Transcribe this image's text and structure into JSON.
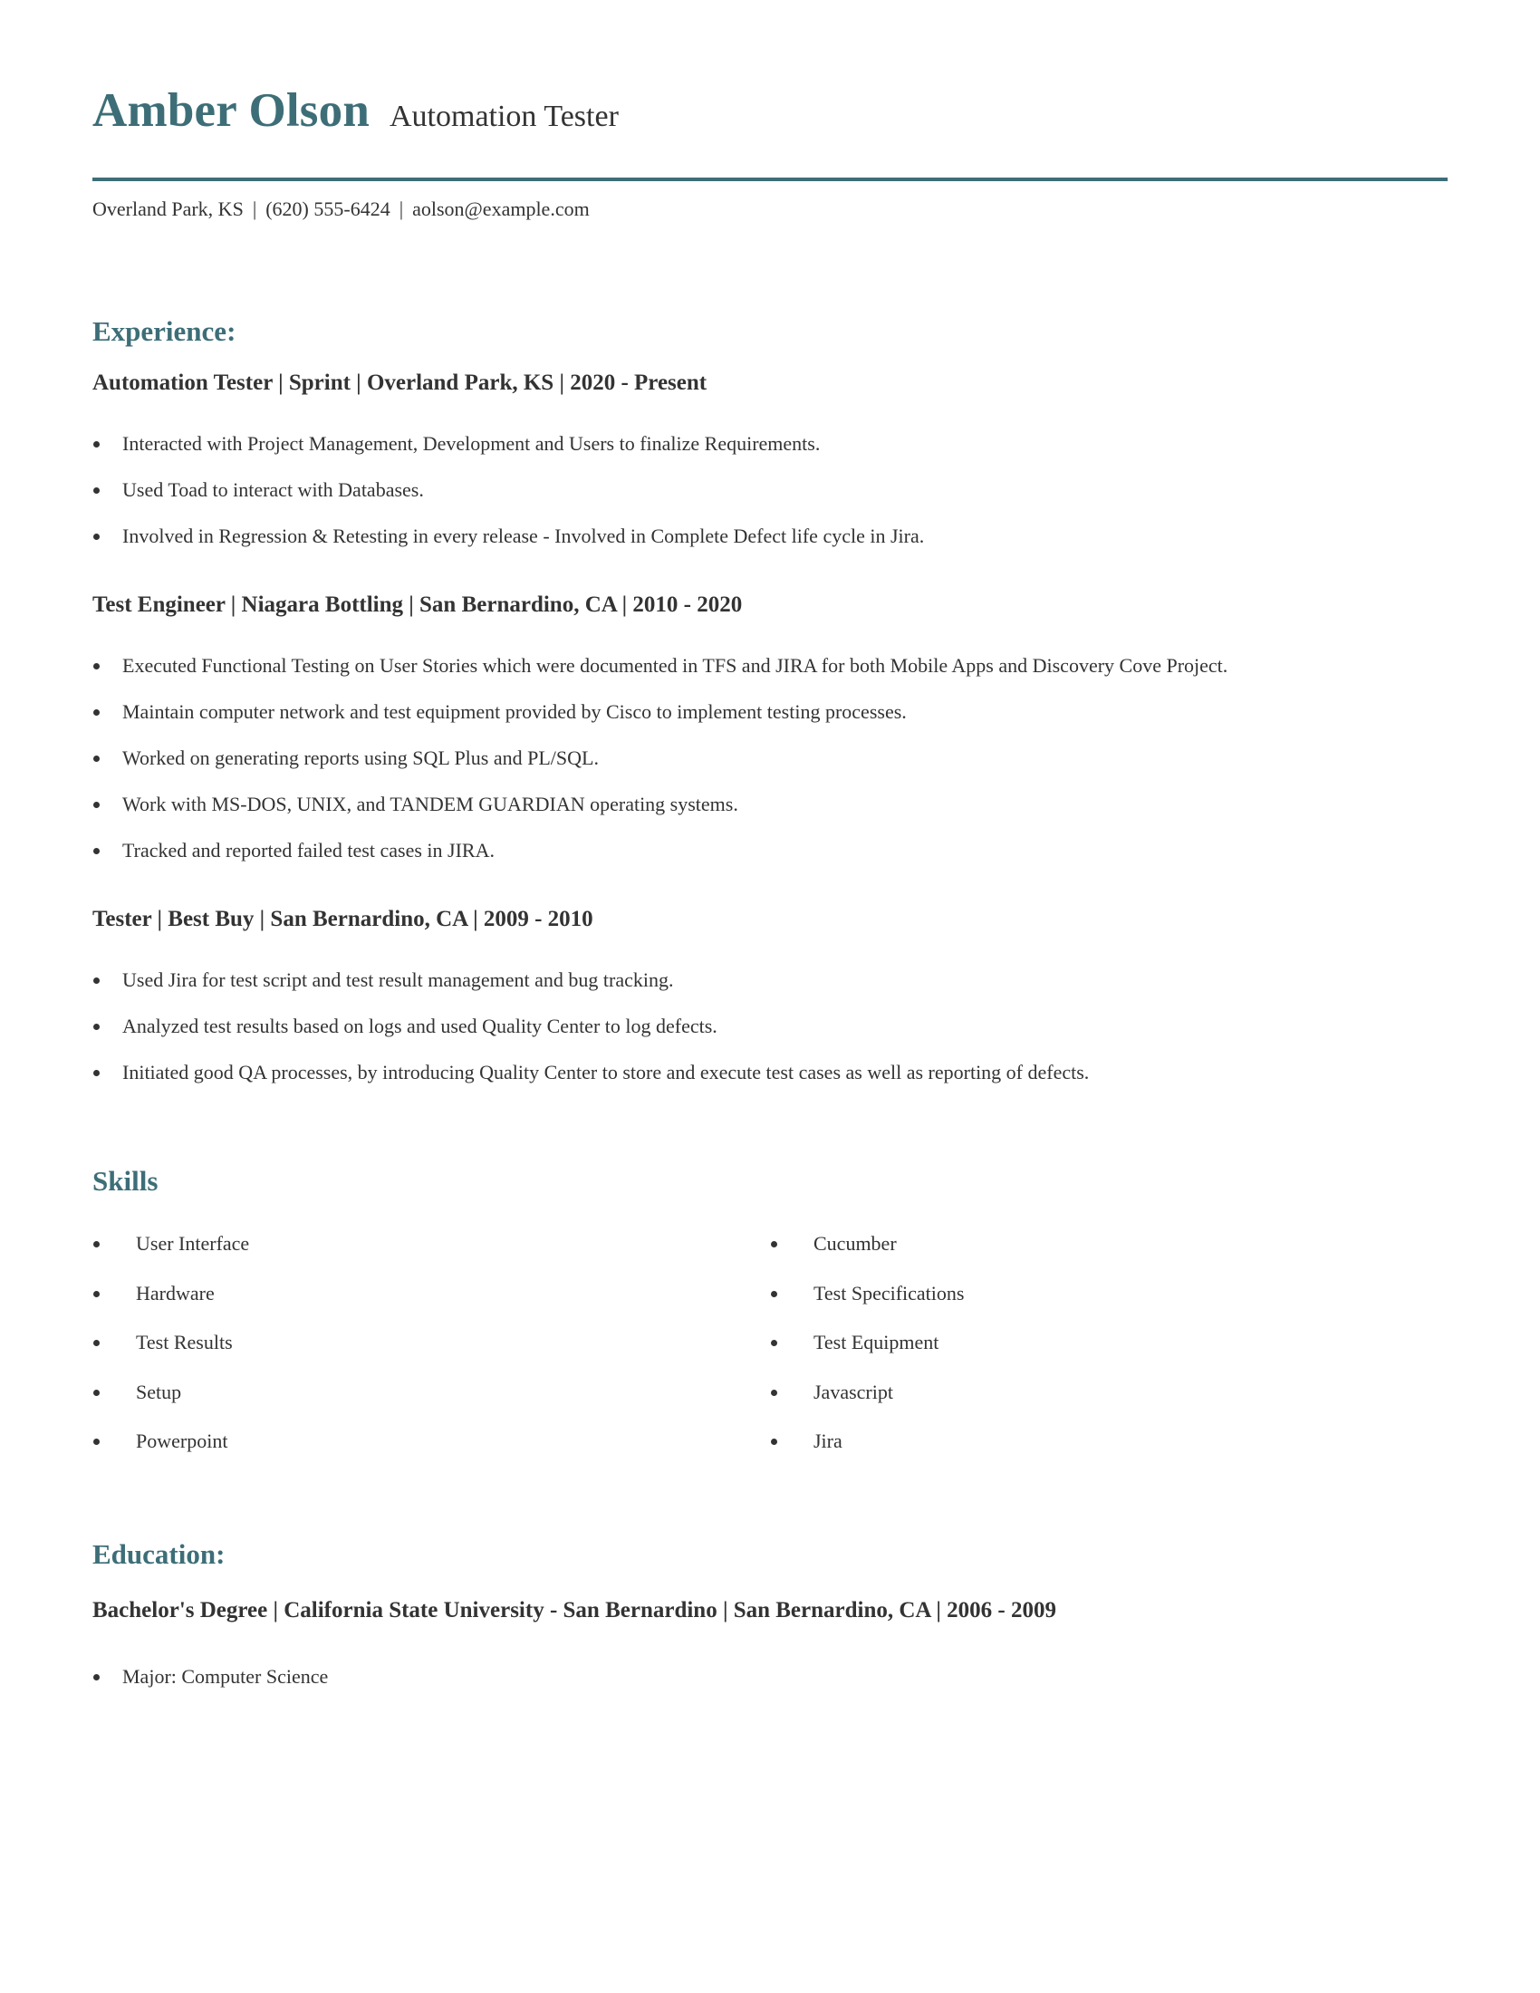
{
  "header": {
    "name": "Amber Olson",
    "role": "Automation Tester",
    "contact": {
      "location": "Overland Park, KS",
      "phone": "(620) 555-6424",
      "email": "aolson@example.com",
      "separator": "|"
    }
  },
  "experience": {
    "title": "Experience:",
    "jobs": [
      {
        "heading": "Automation Tester | Sprint | Overland Park, KS |  2020 - Present",
        "bullets": [
          "Interacted with Project Management, Development and Users to finalize Requirements.",
          "Used Toad to interact with Databases.",
          "Involved in Regression & Retesting in every release - Involved in Complete Defect life cycle in Jira."
        ]
      },
      {
        "heading": "Test Engineer | Niagara Bottling | San Bernardino, CA |  2010 - 2020",
        "bullets": [
          "Executed Functional Testing on User Stories which were documented in TFS and JIRA for both Mobile Apps and Discovery Cove Project.",
          "Maintain computer network and test equipment provided by Cisco to implement testing processes.",
          "Worked on generating reports using SQL Plus and PL/SQL.",
          "Work with MS-DOS, UNIX, and TANDEM GUARDIAN operating systems.",
          "Tracked and reported failed test cases in JIRA."
        ]
      },
      {
        "heading": "Tester | Best Buy | San Bernardino, CA |  2009 - 2010",
        "bullets": [
          "Used Jira for test script and test result management and bug tracking.",
          "Analyzed test results based on logs and used Quality Center to log defects.",
          "Initiated good QA processes, by introducing Quality Center to store and execute test cases as well as reporting of defects."
        ]
      }
    ]
  },
  "skills": {
    "title": "Skills",
    "left": [
      "User Interface",
      "Hardware",
      "Test Results",
      "Setup",
      "Powerpoint"
    ],
    "right": [
      "Cucumber",
      "Test Specifications",
      "Test Equipment",
      "Javascript",
      "Jira"
    ]
  },
  "education": {
    "title": "Education:",
    "heading": "Bachelor's Degree | California State University - San Bernardino | San Bernardino, CA |  2006 - 2009",
    "bullets": [
      "Major: Computer Science"
    ]
  },
  "colors": {
    "accent": "#3d6e78",
    "text": "#333333"
  }
}
